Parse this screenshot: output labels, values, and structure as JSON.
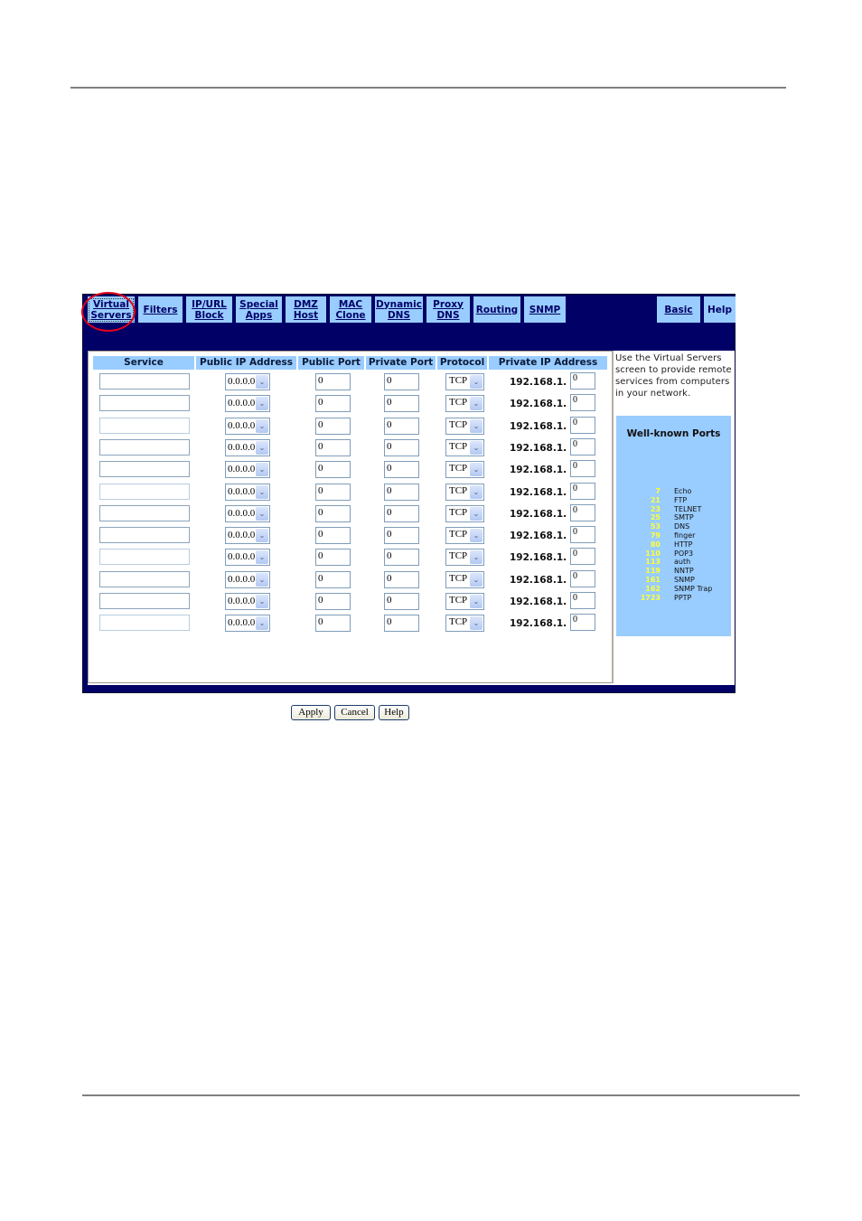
{
  "tabs": [
    {
      "line1": "Virtual",
      "line2": "Servers",
      "active": true
    },
    {
      "line1": "Filters",
      "line2": ""
    },
    {
      "line1": "IP/URL",
      "line2": "Block"
    },
    {
      "line1": "Special",
      "line2": "Apps"
    },
    {
      "line1": "DMZ",
      "line2": "Host"
    },
    {
      "line1": "MAC",
      "line2": "Clone"
    },
    {
      "line1": "Dynamic",
      "line2": "DNS"
    },
    {
      "line1": "Proxy",
      "line2": "DNS"
    },
    {
      "line1": "Routing",
      "line2": ""
    },
    {
      "line1": "SNMP",
      "line2": ""
    },
    {
      "line1": "Basic",
      "line2": ""
    },
    {
      "line1": "Help",
      "line2": ""
    }
  ],
  "table": {
    "headers": [
      "Service",
      "Public IP Address",
      "Public Port",
      "Private Port",
      "Protocol",
      "Private IP Address"
    ],
    "rows": [
      {
        "service": "",
        "public_ip": "0.0.0.0",
        "public_port": "0",
        "private_port": "0",
        "protocol": "TCP",
        "ip_prefix": "192.168.1.",
        "ip_last": "0"
      },
      {
        "service": "",
        "public_ip": "0.0.0.0",
        "public_port": "0",
        "private_port": "0",
        "protocol": "TCP",
        "ip_prefix": "192.168.1.",
        "ip_last": "0"
      },
      {
        "service": "",
        "public_ip": "0.0.0.0",
        "public_port": "0",
        "private_port": "0",
        "protocol": "TCP",
        "ip_prefix": "192.168.1.",
        "ip_last": "0"
      },
      {
        "service": "",
        "public_ip": "0.0.0.0",
        "public_port": "0",
        "private_port": "0",
        "protocol": "TCP",
        "ip_prefix": "192.168.1.",
        "ip_last": "0"
      },
      {
        "service": "",
        "public_ip": "0.0.0.0",
        "public_port": "0",
        "private_port": "0",
        "protocol": "TCP",
        "ip_prefix": "192.168.1.",
        "ip_last": "0"
      },
      {
        "service": "",
        "public_ip": "0.0.0.0",
        "public_port": "0",
        "private_port": "0",
        "protocol": "TCP",
        "ip_prefix": "192.168.1.",
        "ip_last": "0"
      },
      {
        "service": "",
        "public_ip": "0.0.0.0",
        "public_port": "0",
        "private_port": "0",
        "protocol": "TCP",
        "ip_prefix": "192.168.1.",
        "ip_last": "0"
      },
      {
        "service": "",
        "public_ip": "0.0.0.0",
        "public_port": "0",
        "private_port": "0",
        "protocol": "TCP",
        "ip_prefix": "192.168.1.",
        "ip_last": "0"
      },
      {
        "service": "",
        "public_ip": "0.0.0.0",
        "public_port": "0",
        "private_port": "0",
        "protocol": "TCP",
        "ip_prefix": "192.168.1.",
        "ip_last": "0"
      },
      {
        "service": "",
        "public_ip": "0.0.0.0",
        "public_port": "0",
        "private_port": "0",
        "protocol": "TCP",
        "ip_prefix": "192.168.1.",
        "ip_last": "0"
      },
      {
        "service": "",
        "public_ip": "0.0.0.0",
        "public_port": "0",
        "private_port": "0",
        "protocol": "TCP",
        "ip_prefix": "192.168.1.",
        "ip_last": "0"
      },
      {
        "service": "",
        "public_ip": "0.0.0.0",
        "public_port": "0",
        "private_port": "0",
        "protocol": "TCP",
        "ip_prefix": "192.168.1.",
        "ip_last": "0"
      }
    ]
  },
  "buttons": {
    "apply": "Apply",
    "cancel": "Cancel",
    "help": "Help"
  },
  "side": {
    "help_text": "Use the Virtual Servers screen to provide remote services from computers in your network.",
    "ports_title": "Well-known Ports",
    "ports": [
      {
        "port": "7",
        "name": "Echo"
      },
      {
        "port": "21",
        "name": "FTP"
      },
      {
        "port": "23",
        "name": "TELNET"
      },
      {
        "port": "25",
        "name": "SMTP"
      },
      {
        "port": "53",
        "name": "DNS"
      },
      {
        "port": "79",
        "name": "finger"
      },
      {
        "port": "80",
        "name": "HTTP"
      },
      {
        "port": "110",
        "name": "POP3"
      },
      {
        "port": "113",
        "name": "auth"
      },
      {
        "port": "119",
        "name": "NNTP"
      },
      {
        "port": "161",
        "name": "SNMP"
      },
      {
        "port": "162",
        "name": "SNMP Trap"
      },
      {
        "port": "1723",
        "name": "PPTP"
      }
    ]
  },
  "colors": {
    "nav_background": "#000066",
    "tab_background": "#99ccff",
    "highlight_ring": "#e0001a",
    "port_number": "#ffff33"
  }
}
